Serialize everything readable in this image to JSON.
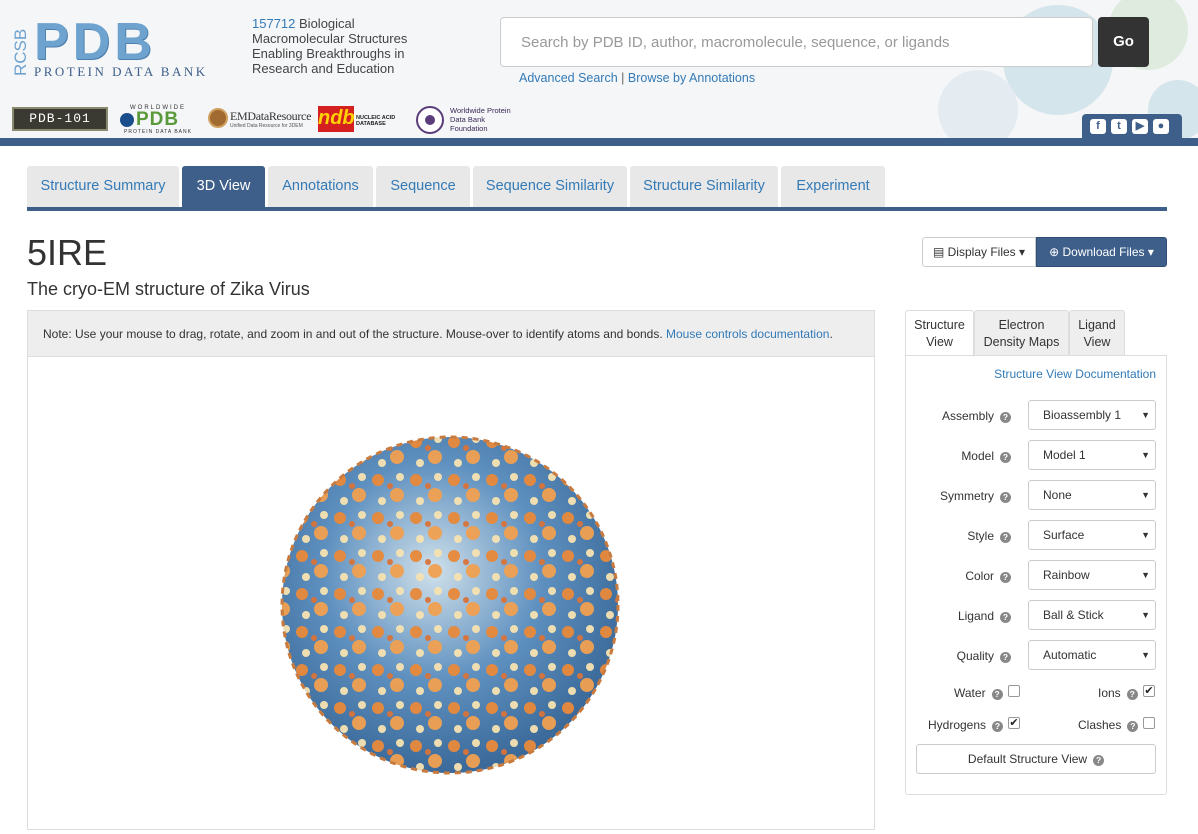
{
  "header": {
    "logo_side": "RCSB",
    "logo_main": "PDB",
    "logo_sub": "PROTEIN DATA BANK",
    "structure_count": "157712",
    "tagline": "Biological Macromolecular Structures Enabling Breakthroughs in Research and Education",
    "search_placeholder": "Search by PDB ID, author, macromolecule, sequence, or ligands",
    "go_label": "Go",
    "advanced_search": "Advanced Search",
    "separator": "|",
    "browse_annotations": "Browse by Annotations",
    "partners": {
      "pdb101": "PDB-101",
      "wwpdb_top": "WORLDWIDE",
      "wwpdb_main": "PDB",
      "wwpdb_sub": "PROTEIN DATA BANK",
      "emdr_main": "EMDataResource",
      "emdr_sub": "Unified Data Resource for 3DEM",
      "ndb_mark": "ndb",
      "ndb_text": "NUCLEIC ACID DATABASE",
      "wwpdbf_text": "Worldwide Protein Data Bank Foundation"
    },
    "social_icons": [
      "facebook-icon",
      "twitter-icon",
      "youtube-icon",
      "github-icon"
    ]
  },
  "tabs": [
    {
      "label": "Structure Summary",
      "active": false
    },
    {
      "label": "3D View",
      "active": true
    },
    {
      "label": "Annotations",
      "active": false
    },
    {
      "label": "Sequence",
      "active": false
    },
    {
      "label": "Sequence Similarity",
      "active": false
    },
    {
      "label": "Structure Similarity",
      "active": false
    },
    {
      "label": "Experiment",
      "active": false
    }
  ],
  "entry": {
    "id": "5IRE",
    "title": "The cryo-EM structure of Zika Virus"
  },
  "buttons": {
    "display_files": "Display Files",
    "download_files": "Download Files"
  },
  "viewer": {
    "note": "Note: Use your mouse to drag, rotate, and zoom in and out of the structure. Mouse-over to identify atoms and bonds.",
    "doc_link": "Mouse controls documentation",
    "note_end": "."
  },
  "panel": {
    "tabs": [
      {
        "line1": "Structure",
        "line2": "View",
        "active": true
      },
      {
        "line1": "Electron",
        "line2": "Density Maps",
        "active": false
      },
      {
        "line1": "Ligand",
        "line2": "View",
        "active": false
      }
    ],
    "doc_link": "Structure View Documentation",
    "fields": [
      {
        "label": "Assembly",
        "value": "Bioassembly 1"
      },
      {
        "label": "Model",
        "value": "Model 1"
      },
      {
        "label": "Symmetry",
        "value": "None"
      },
      {
        "label": "Style",
        "value": "Surface"
      },
      {
        "label": "Color",
        "value": "Rainbow"
      },
      {
        "label": "Ligand",
        "value": "Ball & Stick"
      },
      {
        "label": "Quality",
        "value": "Automatic"
      }
    ],
    "checkboxes": {
      "water": {
        "label": "Water",
        "checked": false
      },
      "ions": {
        "label": "Ions",
        "checked": true
      },
      "hydrogens": {
        "label": "Hydrogens",
        "checked": true
      },
      "clashes": {
        "label": "Clashes",
        "checked": false
      }
    },
    "default_view": "Default Structure View",
    "help_glyph": "?",
    "caret": "▼"
  },
  "colors": {
    "brand": "#3e5f8a",
    "link": "#337ab7",
    "logo": "#6fa3cf"
  }
}
